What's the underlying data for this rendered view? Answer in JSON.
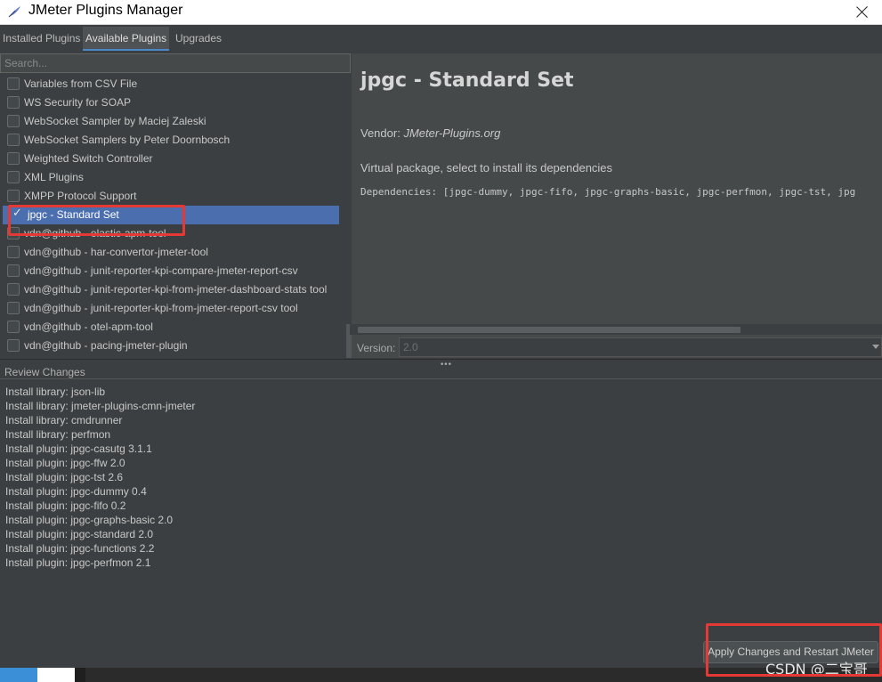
{
  "window": {
    "title": "JMeter Plugins Manager"
  },
  "tabs": [
    {
      "label": "Installed Plugins",
      "active": false
    },
    {
      "label": "Available Plugins",
      "active": true
    },
    {
      "label": "Upgrades",
      "active": false
    }
  ],
  "search": {
    "placeholder": "Search..."
  },
  "plugins": [
    {
      "label": "Variables from CSV File",
      "checked": false
    },
    {
      "label": "WS Security for SOAP",
      "checked": false
    },
    {
      "label": "WebSocket Sampler by Maciej Zaleski",
      "checked": false
    },
    {
      "label": "WebSocket Samplers by Peter Doornbosch",
      "checked": false
    },
    {
      "label": "Weighted Switch Controller",
      "checked": false
    },
    {
      "label": "XML Plugins",
      "checked": false
    },
    {
      "label": "XMPP Protocol Support",
      "checked": false
    },
    {
      "label": "jpgc - Standard Set",
      "checked": true,
      "selected": true
    },
    {
      "label": "vdn@github - elastic-apm-tool",
      "checked": false
    },
    {
      "label": "vdn@github - har-convertor-jmeter-tool",
      "checked": false
    },
    {
      "label": "vdn@github - junit-reporter-kpi-compare-jmeter-report-csv",
      "checked": false
    },
    {
      "label": "vdn@github - junit-reporter-kpi-from-jmeter-dashboard-stats tool",
      "checked": false
    },
    {
      "label": "vdn@github - junit-reporter-kpi-from-jmeter-report-csv tool",
      "checked": false
    },
    {
      "label": "vdn@github - otel-apm-tool",
      "checked": false
    },
    {
      "label": "vdn@github - pacing-jmeter-plugin",
      "checked": false
    }
  ],
  "detail": {
    "title": "jpgc - Standard Set",
    "vendor_label": "Vendor: ",
    "vendor_value": "JMeter-Plugins.org",
    "description": "Virtual package, select to install its dependencies",
    "dependencies": "Dependencies: [jpgc-dummy, jpgc-fifo, jpgc-graphs-basic, jpgc-perfmon, jpgc-tst, jpg",
    "version_label": "Version:",
    "version_value": "2.0"
  },
  "review": {
    "header": "Review Changes",
    "lines": [
      "Install library: json-lib",
      "Install library: jmeter-plugins-cmn-jmeter",
      "Install library: cmdrunner",
      "Install library: perfmon",
      "Install plugin: jpgc-casutg 3.1.1",
      "Install plugin: jpgc-ffw 2.0",
      "Install plugin: jpgc-tst 2.6",
      "Install plugin: jpgc-dummy 0.4",
      "Install plugin: jpgc-fifo 0.2",
      "Install plugin: jpgc-graphs-basic 2.0",
      "Install plugin: jpgc-standard 2.0",
      "Install plugin: jpgc-functions 2.2",
      "Install plugin: jpgc-perfmon 2.1"
    ]
  },
  "apply_button": {
    "label": "Apply Changes and Restart JMeter"
  },
  "watermark": "CSDN @二宝哥",
  "colors": {
    "background": "#3c3f41",
    "detail_bg": "#45494a",
    "selection": "#4b6eaf",
    "annotation": "#e53935"
  }
}
